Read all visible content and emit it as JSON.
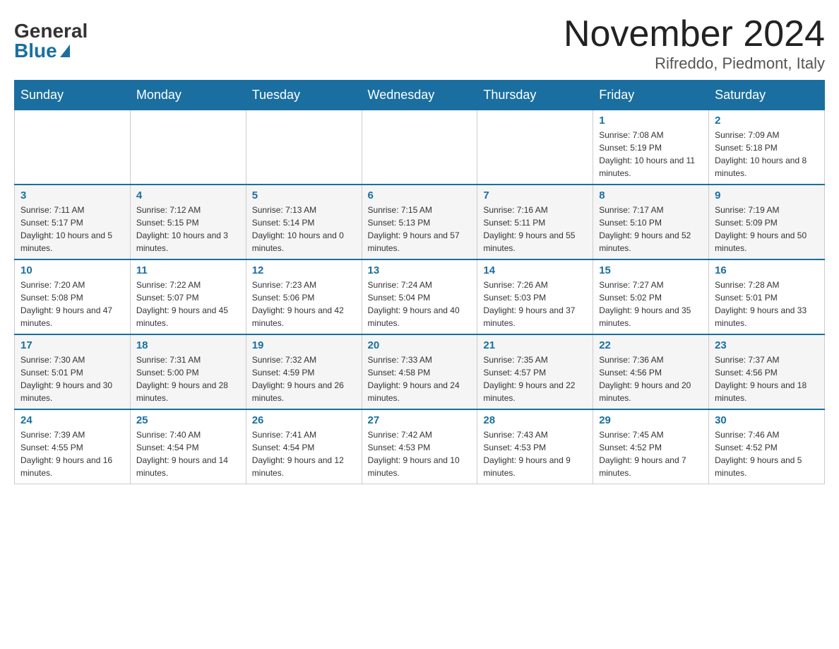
{
  "header": {
    "logo_general": "General",
    "logo_blue": "Blue",
    "title": "November 2024",
    "location": "Rifreddo, Piedmont, Italy"
  },
  "weekdays": [
    "Sunday",
    "Monday",
    "Tuesday",
    "Wednesday",
    "Thursday",
    "Friday",
    "Saturday"
  ],
  "weeks": [
    [
      {
        "day": "",
        "sunrise": "",
        "sunset": "",
        "daylight": ""
      },
      {
        "day": "",
        "sunrise": "",
        "sunset": "",
        "daylight": ""
      },
      {
        "day": "",
        "sunrise": "",
        "sunset": "",
        "daylight": ""
      },
      {
        "day": "",
        "sunrise": "",
        "sunset": "",
        "daylight": ""
      },
      {
        "day": "",
        "sunrise": "",
        "sunset": "",
        "daylight": ""
      },
      {
        "day": "1",
        "sunrise": "Sunrise: 7:08 AM",
        "sunset": "Sunset: 5:19 PM",
        "daylight": "Daylight: 10 hours and 11 minutes."
      },
      {
        "day": "2",
        "sunrise": "Sunrise: 7:09 AM",
        "sunset": "Sunset: 5:18 PM",
        "daylight": "Daylight: 10 hours and 8 minutes."
      }
    ],
    [
      {
        "day": "3",
        "sunrise": "Sunrise: 7:11 AM",
        "sunset": "Sunset: 5:17 PM",
        "daylight": "Daylight: 10 hours and 5 minutes."
      },
      {
        "day": "4",
        "sunrise": "Sunrise: 7:12 AM",
        "sunset": "Sunset: 5:15 PM",
        "daylight": "Daylight: 10 hours and 3 minutes."
      },
      {
        "day": "5",
        "sunrise": "Sunrise: 7:13 AM",
        "sunset": "Sunset: 5:14 PM",
        "daylight": "Daylight: 10 hours and 0 minutes."
      },
      {
        "day": "6",
        "sunrise": "Sunrise: 7:15 AM",
        "sunset": "Sunset: 5:13 PM",
        "daylight": "Daylight: 9 hours and 57 minutes."
      },
      {
        "day": "7",
        "sunrise": "Sunrise: 7:16 AM",
        "sunset": "Sunset: 5:11 PM",
        "daylight": "Daylight: 9 hours and 55 minutes."
      },
      {
        "day": "8",
        "sunrise": "Sunrise: 7:17 AM",
        "sunset": "Sunset: 5:10 PM",
        "daylight": "Daylight: 9 hours and 52 minutes."
      },
      {
        "day": "9",
        "sunrise": "Sunrise: 7:19 AM",
        "sunset": "Sunset: 5:09 PM",
        "daylight": "Daylight: 9 hours and 50 minutes."
      }
    ],
    [
      {
        "day": "10",
        "sunrise": "Sunrise: 7:20 AM",
        "sunset": "Sunset: 5:08 PM",
        "daylight": "Daylight: 9 hours and 47 minutes."
      },
      {
        "day": "11",
        "sunrise": "Sunrise: 7:22 AM",
        "sunset": "Sunset: 5:07 PM",
        "daylight": "Daylight: 9 hours and 45 minutes."
      },
      {
        "day": "12",
        "sunrise": "Sunrise: 7:23 AM",
        "sunset": "Sunset: 5:06 PM",
        "daylight": "Daylight: 9 hours and 42 minutes."
      },
      {
        "day": "13",
        "sunrise": "Sunrise: 7:24 AM",
        "sunset": "Sunset: 5:04 PM",
        "daylight": "Daylight: 9 hours and 40 minutes."
      },
      {
        "day": "14",
        "sunrise": "Sunrise: 7:26 AM",
        "sunset": "Sunset: 5:03 PM",
        "daylight": "Daylight: 9 hours and 37 minutes."
      },
      {
        "day": "15",
        "sunrise": "Sunrise: 7:27 AM",
        "sunset": "Sunset: 5:02 PM",
        "daylight": "Daylight: 9 hours and 35 minutes."
      },
      {
        "day": "16",
        "sunrise": "Sunrise: 7:28 AM",
        "sunset": "Sunset: 5:01 PM",
        "daylight": "Daylight: 9 hours and 33 minutes."
      }
    ],
    [
      {
        "day": "17",
        "sunrise": "Sunrise: 7:30 AM",
        "sunset": "Sunset: 5:01 PM",
        "daylight": "Daylight: 9 hours and 30 minutes."
      },
      {
        "day": "18",
        "sunrise": "Sunrise: 7:31 AM",
        "sunset": "Sunset: 5:00 PM",
        "daylight": "Daylight: 9 hours and 28 minutes."
      },
      {
        "day": "19",
        "sunrise": "Sunrise: 7:32 AM",
        "sunset": "Sunset: 4:59 PM",
        "daylight": "Daylight: 9 hours and 26 minutes."
      },
      {
        "day": "20",
        "sunrise": "Sunrise: 7:33 AM",
        "sunset": "Sunset: 4:58 PM",
        "daylight": "Daylight: 9 hours and 24 minutes."
      },
      {
        "day": "21",
        "sunrise": "Sunrise: 7:35 AM",
        "sunset": "Sunset: 4:57 PM",
        "daylight": "Daylight: 9 hours and 22 minutes."
      },
      {
        "day": "22",
        "sunrise": "Sunrise: 7:36 AM",
        "sunset": "Sunset: 4:56 PM",
        "daylight": "Daylight: 9 hours and 20 minutes."
      },
      {
        "day": "23",
        "sunrise": "Sunrise: 7:37 AM",
        "sunset": "Sunset: 4:56 PM",
        "daylight": "Daylight: 9 hours and 18 minutes."
      }
    ],
    [
      {
        "day": "24",
        "sunrise": "Sunrise: 7:39 AM",
        "sunset": "Sunset: 4:55 PM",
        "daylight": "Daylight: 9 hours and 16 minutes."
      },
      {
        "day": "25",
        "sunrise": "Sunrise: 7:40 AM",
        "sunset": "Sunset: 4:54 PM",
        "daylight": "Daylight: 9 hours and 14 minutes."
      },
      {
        "day": "26",
        "sunrise": "Sunrise: 7:41 AM",
        "sunset": "Sunset: 4:54 PM",
        "daylight": "Daylight: 9 hours and 12 minutes."
      },
      {
        "day": "27",
        "sunrise": "Sunrise: 7:42 AM",
        "sunset": "Sunset: 4:53 PM",
        "daylight": "Daylight: 9 hours and 10 minutes."
      },
      {
        "day": "28",
        "sunrise": "Sunrise: 7:43 AM",
        "sunset": "Sunset: 4:53 PM",
        "daylight": "Daylight: 9 hours and 9 minutes."
      },
      {
        "day": "29",
        "sunrise": "Sunrise: 7:45 AM",
        "sunset": "Sunset: 4:52 PM",
        "daylight": "Daylight: 9 hours and 7 minutes."
      },
      {
        "day": "30",
        "sunrise": "Sunrise: 7:46 AM",
        "sunset": "Sunset: 4:52 PM",
        "daylight": "Daylight: 9 hours and 5 minutes."
      }
    ]
  ]
}
